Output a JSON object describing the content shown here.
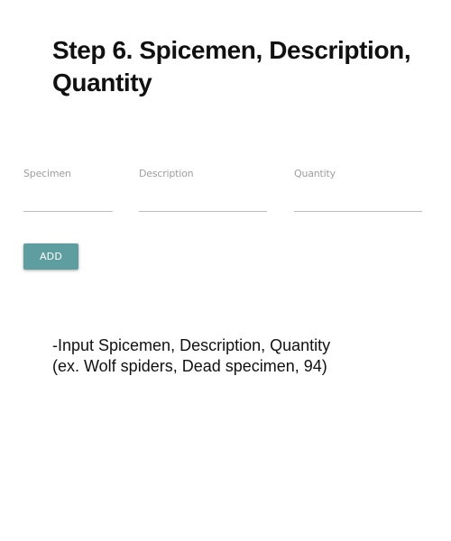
{
  "title": "Step 6. Spicemen, Description,\nQuantity",
  "form": {
    "fields": [
      {
        "label": "Specimen",
        "value": ""
      },
      {
        "label": "Description",
        "value": ""
      },
      {
        "label": "Quantity",
        "value": ""
      }
    ],
    "add_label": "ADD"
  },
  "instructions": {
    "line1": "-Input Spicemen, Description, Quantity",
    "line2": "(ex. Wolf spiders, Dead specimen, 94)"
  },
  "colors": {
    "button_bg": "#5f9ea0",
    "underline": "#bdbdbd",
    "label": "#9e9e9e"
  }
}
